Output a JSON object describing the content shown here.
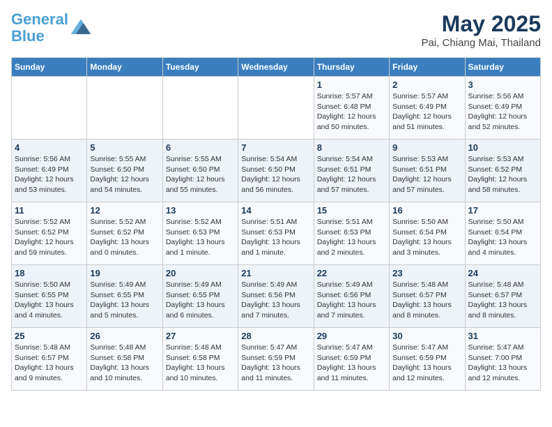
{
  "logo": {
    "line1": "General",
    "line2": "Blue"
  },
  "title": "May 2025",
  "subtitle": "Pai, Chiang Mai, Thailand",
  "days_of_week": [
    "Sunday",
    "Monday",
    "Tuesday",
    "Wednesday",
    "Thursday",
    "Friday",
    "Saturday"
  ],
  "weeks": [
    [
      {
        "num": "",
        "info": ""
      },
      {
        "num": "",
        "info": ""
      },
      {
        "num": "",
        "info": ""
      },
      {
        "num": "",
        "info": ""
      },
      {
        "num": "1",
        "info": "Sunrise: 5:57 AM\nSunset: 6:48 PM\nDaylight: 12 hours\nand 50 minutes."
      },
      {
        "num": "2",
        "info": "Sunrise: 5:57 AM\nSunset: 6:49 PM\nDaylight: 12 hours\nand 51 minutes."
      },
      {
        "num": "3",
        "info": "Sunrise: 5:56 AM\nSunset: 6:49 PM\nDaylight: 12 hours\nand 52 minutes."
      }
    ],
    [
      {
        "num": "4",
        "info": "Sunrise: 5:56 AM\nSunset: 6:49 PM\nDaylight: 12 hours\nand 53 minutes."
      },
      {
        "num": "5",
        "info": "Sunrise: 5:55 AM\nSunset: 6:50 PM\nDaylight: 12 hours\nand 54 minutes."
      },
      {
        "num": "6",
        "info": "Sunrise: 5:55 AM\nSunset: 6:50 PM\nDaylight: 12 hours\nand 55 minutes."
      },
      {
        "num": "7",
        "info": "Sunrise: 5:54 AM\nSunset: 6:50 PM\nDaylight: 12 hours\nand 56 minutes."
      },
      {
        "num": "8",
        "info": "Sunrise: 5:54 AM\nSunset: 6:51 PM\nDaylight: 12 hours\nand 57 minutes."
      },
      {
        "num": "9",
        "info": "Sunrise: 5:53 AM\nSunset: 6:51 PM\nDaylight: 12 hours\nand 57 minutes."
      },
      {
        "num": "10",
        "info": "Sunrise: 5:53 AM\nSunset: 6:52 PM\nDaylight: 12 hours\nand 58 minutes."
      }
    ],
    [
      {
        "num": "11",
        "info": "Sunrise: 5:52 AM\nSunset: 6:52 PM\nDaylight: 12 hours\nand 59 minutes."
      },
      {
        "num": "12",
        "info": "Sunrise: 5:52 AM\nSunset: 6:52 PM\nDaylight: 13 hours\nand 0 minutes."
      },
      {
        "num": "13",
        "info": "Sunrise: 5:52 AM\nSunset: 6:53 PM\nDaylight: 13 hours\nand 1 minute."
      },
      {
        "num": "14",
        "info": "Sunrise: 5:51 AM\nSunset: 6:53 PM\nDaylight: 13 hours\nand 1 minute."
      },
      {
        "num": "15",
        "info": "Sunrise: 5:51 AM\nSunset: 6:53 PM\nDaylight: 13 hours\nand 2 minutes."
      },
      {
        "num": "16",
        "info": "Sunrise: 5:50 AM\nSunset: 6:54 PM\nDaylight: 13 hours\nand 3 minutes."
      },
      {
        "num": "17",
        "info": "Sunrise: 5:50 AM\nSunset: 6:54 PM\nDaylight: 13 hours\nand 4 minutes."
      }
    ],
    [
      {
        "num": "18",
        "info": "Sunrise: 5:50 AM\nSunset: 6:55 PM\nDaylight: 13 hours\nand 4 minutes."
      },
      {
        "num": "19",
        "info": "Sunrise: 5:49 AM\nSunset: 6:55 PM\nDaylight: 13 hours\nand 5 minutes."
      },
      {
        "num": "20",
        "info": "Sunrise: 5:49 AM\nSunset: 6:55 PM\nDaylight: 13 hours\nand 6 minutes."
      },
      {
        "num": "21",
        "info": "Sunrise: 5:49 AM\nSunset: 6:56 PM\nDaylight: 13 hours\nand 7 minutes."
      },
      {
        "num": "22",
        "info": "Sunrise: 5:49 AM\nSunset: 6:56 PM\nDaylight: 13 hours\nand 7 minutes."
      },
      {
        "num": "23",
        "info": "Sunrise: 5:48 AM\nSunset: 6:57 PM\nDaylight: 13 hours\nand 8 minutes."
      },
      {
        "num": "24",
        "info": "Sunrise: 5:48 AM\nSunset: 6:57 PM\nDaylight: 13 hours\nand 8 minutes."
      }
    ],
    [
      {
        "num": "25",
        "info": "Sunrise: 5:48 AM\nSunset: 6:57 PM\nDaylight: 13 hours\nand 9 minutes."
      },
      {
        "num": "26",
        "info": "Sunrise: 5:48 AM\nSunset: 6:58 PM\nDaylight: 13 hours\nand 10 minutes."
      },
      {
        "num": "27",
        "info": "Sunrise: 5:48 AM\nSunset: 6:58 PM\nDaylight: 13 hours\nand 10 minutes."
      },
      {
        "num": "28",
        "info": "Sunrise: 5:47 AM\nSunset: 6:59 PM\nDaylight: 13 hours\nand 11 minutes."
      },
      {
        "num": "29",
        "info": "Sunrise: 5:47 AM\nSunset: 6:59 PM\nDaylight: 13 hours\nand 11 minutes."
      },
      {
        "num": "30",
        "info": "Sunrise: 5:47 AM\nSunset: 6:59 PM\nDaylight: 13 hours\nand 12 minutes."
      },
      {
        "num": "31",
        "info": "Sunrise: 5:47 AM\nSunset: 7:00 PM\nDaylight: 13 hours\nand 12 minutes."
      }
    ]
  ]
}
